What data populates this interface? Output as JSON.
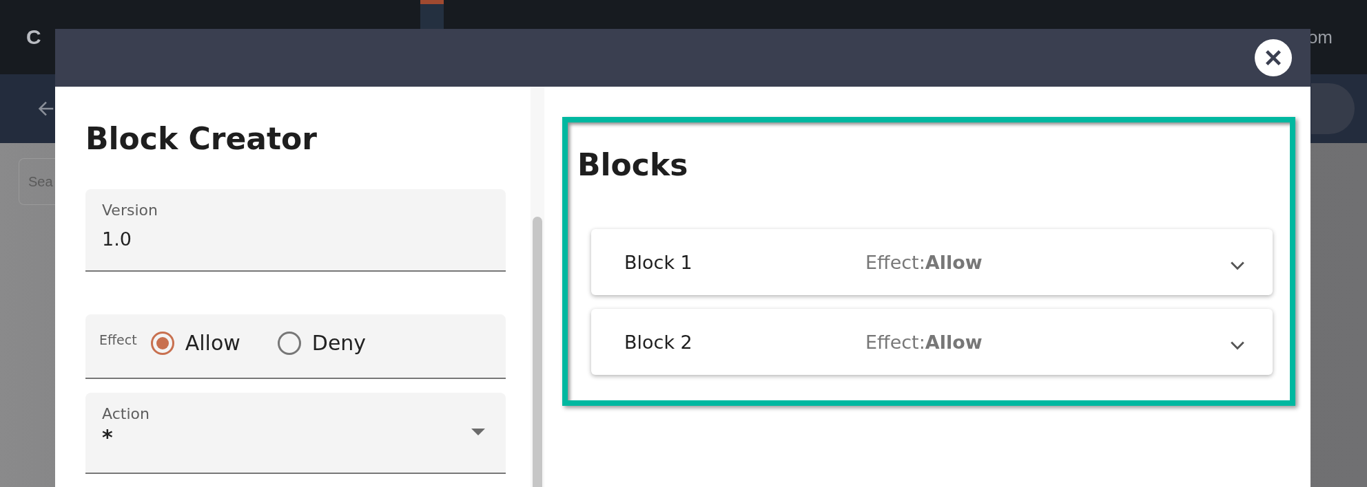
{
  "page": {
    "brand": "C",
    "header_right": "om",
    "search": {
      "placeholder": "Sea"
    }
  },
  "modal": {
    "creator": {
      "title": "Block Creator",
      "version": {
        "label": "Version",
        "value": "1.0"
      },
      "effect": {
        "label": "Effect",
        "options": [
          {
            "label": "Allow",
            "selected": true
          },
          {
            "label": "Deny",
            "selected": false
          }
        ]
      },
      "action": {
        "label": "Action",
        "value": "*"
      }
    },
    "blocks": {
      "title": "Blocks",
      "items": [
        {
          "name": "Block 1",
          "effect": "Effect:**Allow**"
        },
        {
          "name": "Block 2",
          "effect": "Effect:**Allow**"
        }
      ]
    }
  }
}
